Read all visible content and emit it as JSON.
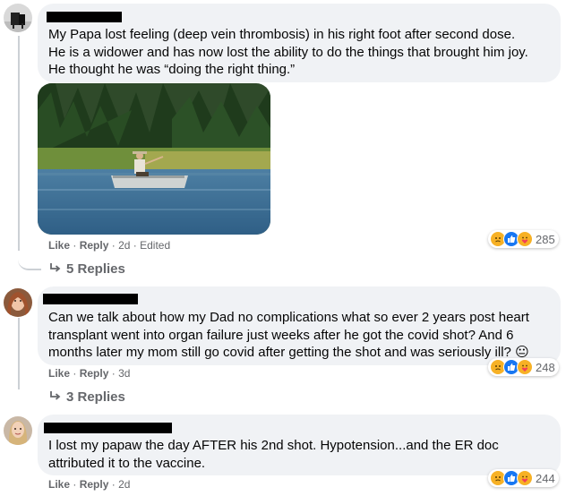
{
  "comments": [
    {
      "text_lines": [
        "My Papa lost feeling (deep vein thrombosis) in his right foot after second dose.",
        "He is a widower and has now lost the ability to do the things that brought him joy.",
        "He thought he was “doing the right thing.”"
      ],
      "like": "Like",
      "reply": "Reply",
      "sep": "·",
      "time": "2d",
      "edited": "Edited",
      "reaction_count": "285",
      "replies": "5 Replies"
    },
    {
      "text_lines": [
        "Can we talk about how my Dad no complications what so ever 2 years post heart",
        "transplant went into organ failure just weeks after he got the covid shot? And 6",
        "months later my mom still go covid after getting the shot and was seriously ill?"
      ],
      "emoji": "😐",
      "like": "Like",
      "reply": "Reply",
      "sep": "·",
      "time": "3d",
      "reaction_count": "248",
      "replies": "3 Replies"
    },
    {
      "text_lines": [
        "I lost my papaw the day AFTER his 2nd shot. Hypotension...and the ER doc",
        "attributed it to the vaccine."
      ],
      "like": "Like",
      "reply": "Reply",
      "sep": "·",
      "time": "2d",
      "reaction_count": "244"
    }
  ],
  "reaction_icons": [
    "sad-icon",
    "like-icon",
    "care-icon"
  ],
  "colors": {
    "bubble": "#f0f2f5",
    "meta": "#65676b",
    "like_blue": "#1877f2",
    "sad_yellow": "#f7b125"
  }
}
